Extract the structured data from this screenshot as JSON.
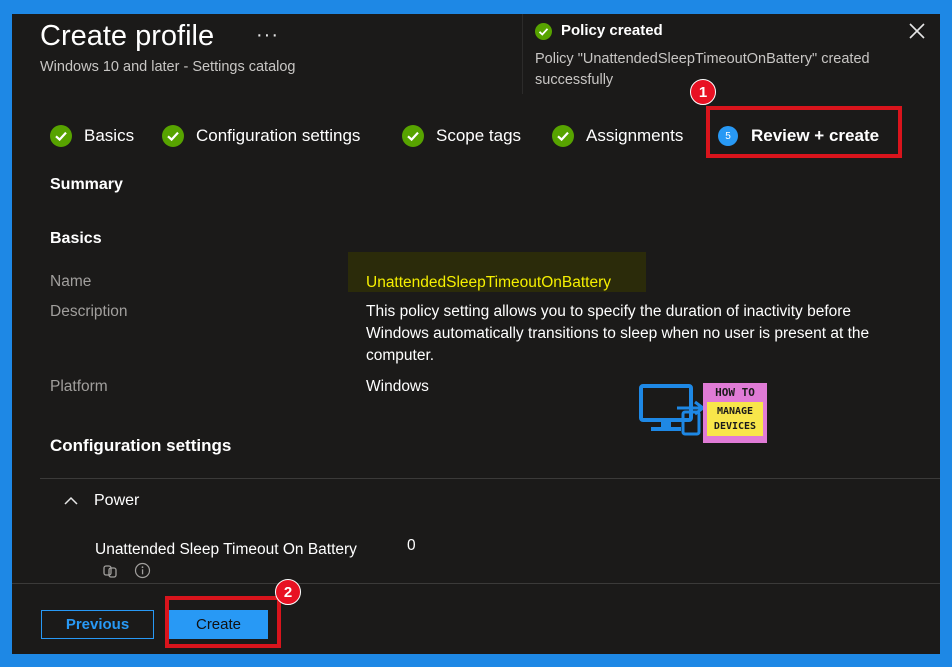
{
  "header": {
    "title": "Create profile",
    "more_label": "···",
    "subtitle": "Windows 10 and later - Settings catalog"
  },
  "toast": {
    "title": "Policy created",
    "message": "Policy \"UnattendedSleepTimeoutOnBattery\" created successfully",
    "status_color": "#57a300"
  },
  "steps": [
    {
      "label": "Basics",
      "state": "complete"
    },
    {
      "label": "Configuration settings",
      "state": "complete"
    },
    {
      "label": "Scope tags",
      "state": "complete"
    },
    {
      "label": "Assignments",
      "state": "complete"
    },
    {
      "label": "Review + create",
      "number": "5",
      "state": "current"
    }
  ],
  "annotations": {
    "badge_1": "1",
    "badge_2": "2",
    "highlight_color": "#d9141c"
  },
  "summary": {
    "heading": "Summary",
    "basics_heading": "Basics",
    "name_label": "Name",
    "name_value": "UnattendedSleepTimeoutOnBattery",
    "description_label": "Description",
    "description_value": "This policy setting allows you to specify the duration of inactivity before Windows automatically transitions to sleep when no user is present at the computer.",
    "platform_label": "Platform",
    "platform_value": "Windows",
    "config_heading": "Configuration settings"
  },
  "config": {
    "group_label": "Power",
    "setting_label": "Unattended Sleep Timeout On Battery",
    "setting_value": "0"
  },
  "watermark": {
    "line1": "HOW TO",
    "line2": "MANAGE",
    "line3": "DEVICES"
  },
  "footer": {
    "previous_label": "Previous",
    "create_label": "Create"
  },
  "colors": {
    "accent": "#2899f5",
    "background": "#1b1a19",
    "frame": "#1e88e5"
  }
}
